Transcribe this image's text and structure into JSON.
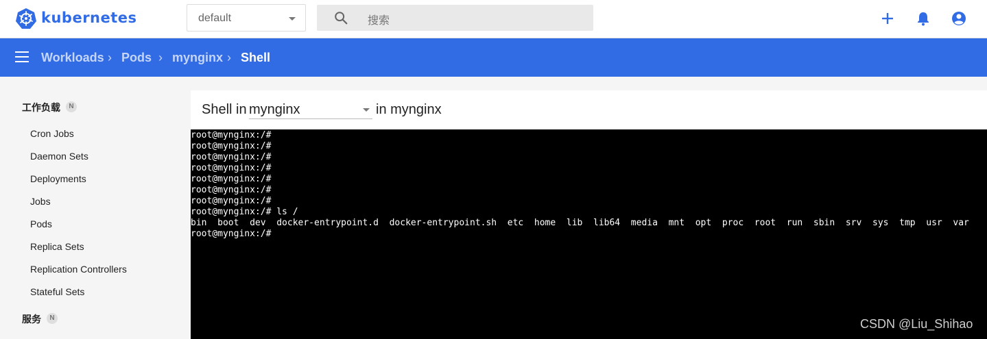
{
  "app": {
    "brand": "kubernetes"
  },
  "header": {
    "namespace": "default",
    "search_placeholder": "搜索",
    "icons": [
      "plus-icon",
      "bell-icon",
      "account-icon"
    ],
    "accent": "#326ce5"
  },
  "breadcrumb": [
    "Workloads",
    "Pods",
    "mynginx",
    "Shell"
  ],
  "sidebar": {
    "section1": {
      "title": "工作负载",
      "badge": "N"
    },
    "items": [
      "Cron Jobs",
      "Daemon Sets",
      "Deployments",
      "Jobs",
      "Pods",
      "Replica Sets",
      "Replication Controllers",
      "Stateful Sets"
    ],
    "section2": {
      "title": "服务",
      "badge": "N"
    }
  },
  "shell": {
    "prefix": "Shell in",
    "container": "mynginx",
    "suffix": "in mynginx",
    "lines": [
      "root@mynginx:/#",
      "root@mynginx:/#",
      "root@mynginx:/#",
      "root@mynginx:/#",
      "root@mynginx:/#",
      "root@mynginx:/#",
      "root@mynginx:/#",
      "root@mynginx:/# ls /",
      "bin  boot  dev  docker-entrypoint.d  docker-entrypoint.sh  etc  home  lib  lib64  media  mnt  opt  proc  root  run  sbin  srv  sys  tmp  usr  var",
      "root@mynginx:/#"
    ]
  },
  "watermark": "CSDN @Liu_Shihao"
}
